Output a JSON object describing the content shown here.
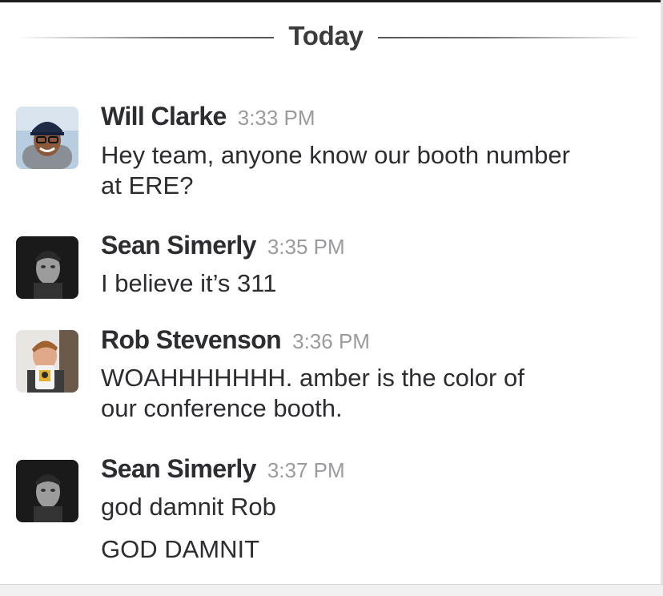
{
  "divider": {
    "label": "Today"
  },
  "messages": [
    {
      "sender": "Will Clarke",
      "time": "3:33 PM",
      "avatar": "user-photo-will-clarke",
      "lines": [
        "Hey team, anyone know our booth number",
        "at ERE?"
      ]
    },
    {
      "sender": "Sean Simerly",
      "time": "3:35 PM",
      "avatar": "user-photo-sean-simerly",
      "lines": [
        "I believe it’s 311"
      ]
    },
    {
      "sender": "Rob Stevenson",
      "time": "3:36 PM",
      "avatar": "user-photo-rob-stevenson",
      "lines": [
        "WOAHHHHHHH. amber is the color of",
        "our conference booth."
      ]
    },
    {
      "sender": "Sean Simerly",
      "time": "3:37 PM",
      "avatar": "user-photo-sean-simerly",
      "lines": [
        "god damnit Rob",
        "GOD DAMNIT"
      ]
    }
  ],
  "colors": {
    "text": "#2c2d30",
    "timestamp": "#9a9b9e",
    "divider": "#6f6f6f"
  }
}
